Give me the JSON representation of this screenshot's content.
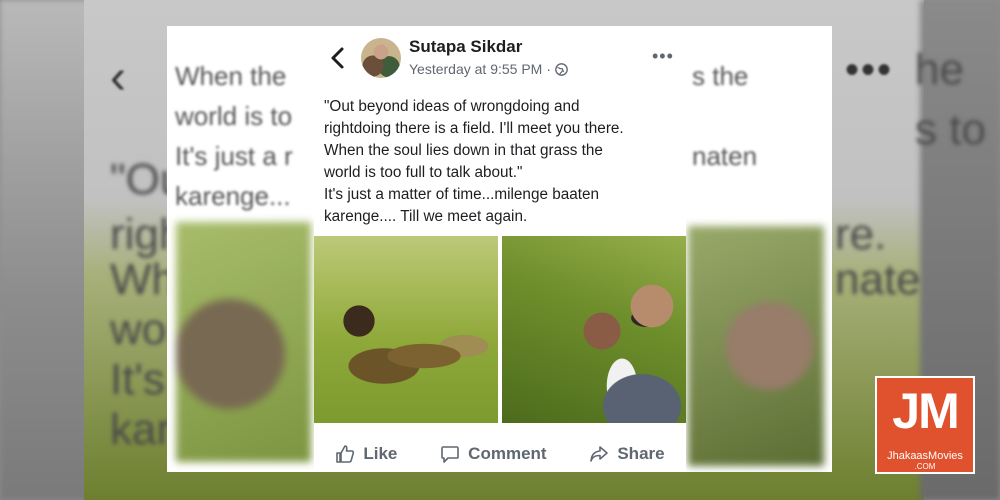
{
  "post": {
    "author": "Sutapa Sikdar",
    "timestamp": "Yesterday at 9:55 PM",
    "separator": "·",
    "privacy_icon": "globe-icon",
    "text_lines": [
      "\"Out beyond ideas of wrongdoing and",
      "rightdoing there is a field. I'll meet you there.",
      "When the soul lies down in that grass the",
      "world is too full to talk about.\"",
      "It's just a matter of time...milenge baaten",
      "karenge.... Till we meet again."
    ],
    "actions": {
      "like": "Like",
      "comment": "Comment",
      "share": "Share"
    }
  },
  "background_blur_text": {
    "left_lines": [
      "When the",
      "world is to",
      "It's just a r",
      "karenge..."
    ],
    "left_large": [
      "\"Ou",
      "righ",
      "Wh",
      "wor",
      "It's",
      "kar"
    ],
    "right_lines": [
      "s the",
      "naten"
    ],
    "right_large": [
      "re.",
      "nate",
      "s to",
      "he"
    ]
  },
  "watermark": {
    "mark": "JM",
    "name": "JhakaasMovies",
    "domain": ".COM"
  },
  "colors": {
    "text_primary": "#1c1e21",
    "text_secondary": "#606770",
    "logo_bg": "#e0512e"
  }
}
